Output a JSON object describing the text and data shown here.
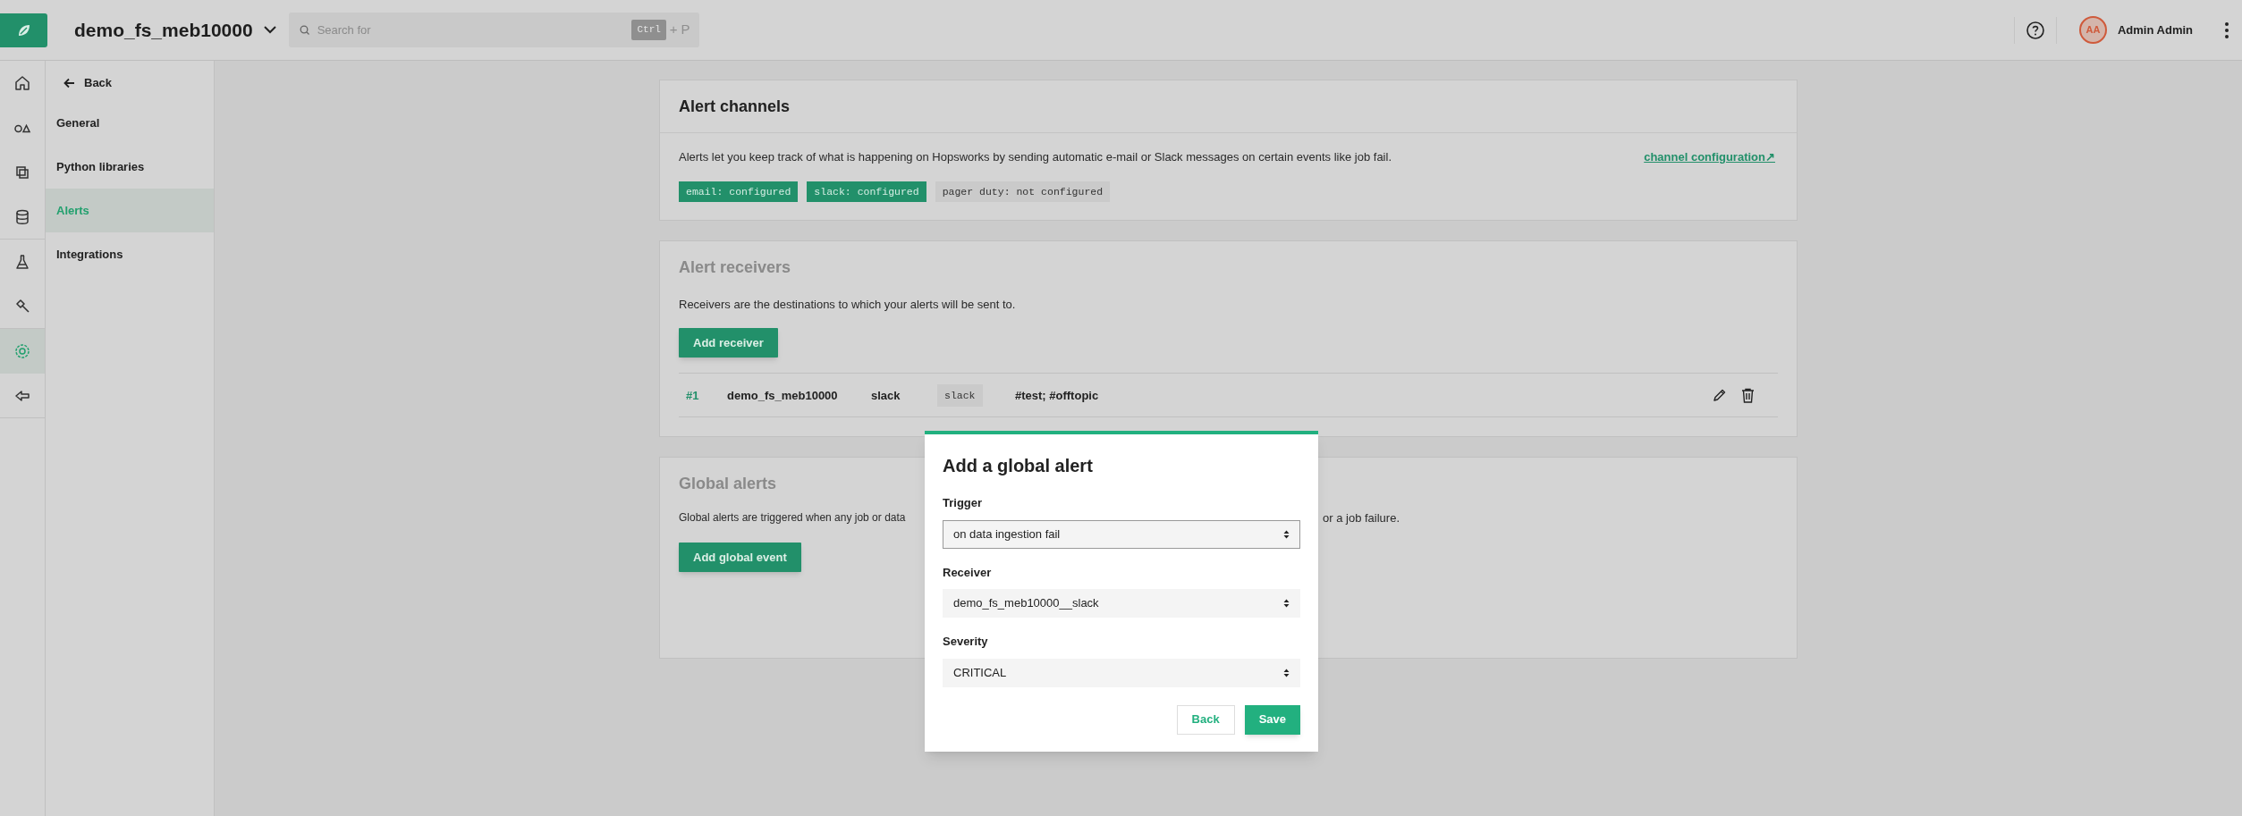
{
  "header": {
    "project": "demo_fs_meb10000",
    "search": {
      "placeholder": "Search for",
      "shortcut_key": "Ctrl",
      "shortcut_plus": "+",
      "shortcut_letter": "P"
    },
    "user": {
      "initials": "AA",
      "name": "Admin Admin"
    }
  },
  "icon_rail": [
    {
      "selected": false
    },
    {
      "selected": false
    },
    {
      "selected": false
    },
    {
      "selected": false
    },
    {
      "selected": false
    },
    {
      "selected": false
    },
    {
      "selected": true
    },
    {
      "selected": false
    }
  ],
  "sidebar": {
    "back": "Back",
    "items": [
      {
        "label": "General",
        "selected": false
      },
      {
        "label": "Python libraries",
        "selected": false
      },
      {
        "label": "Alerts",
        "selected": true
      },
      {
        "label": "Integrations",
        "selected": false
      }
    ]
  },
  "alert_channels": {
    "title": "Alert channels",
    "title_muted": false,
    "description": "Alerts let you keep track of what is happening on Hopsworks by sending automatic e-mail or Slack messages on certain events like job fail.",
    "link": "channel configuration↗",
    "badges": [
      {
        "label": "email: configured",
        "configured": true
      },
      {
        "label": "slack: configured",
        "configured": true
      },
      {
        "label": "pager duty: not configured",
        "configured": false
      }
    ]
  },
  "alert_receivers": {
    "title": "Alert receivers",
    "title_muted": true,
    "description": "Receivers are the destinations to which your alerts will be sent to.",
    "button": "Add receiver",
    "rows": [
      {
        "index": "#1",
        "name": "demo_fs_meb10000",
        "type": "slack",
        "tag": "slack",
        "channels": "#test; #offtopic"
      }
    ]
  },
  "global_alerts": {
    "title": "Global alerts",
    "title_muted": true,
    "description_start": "Global alerts are triggered when any job or data",
    "description_end": "or a job failure.",
    "button": "Add global event"
  },
  "dialog": {
    "title": "Add a global alert",
    "fields": [
      {
        "label": "Trigger",
        "value": "on data ingestion fail",
        "focused": true
      },
      {
        "label": "Receiver",
        "value": "demo_fs_meb10000__slack",
        "focused": false
      },
      {
        "label": "Severity",
        "value": "CRITICAL",
        "focused": false
      }
    ],
    "buttons": [
      {
        "label": "Back",
        "kind": "secondary"
      },
      {
        "label": "Save",
        "kind": "primary"
      }
    ]
  }
}
